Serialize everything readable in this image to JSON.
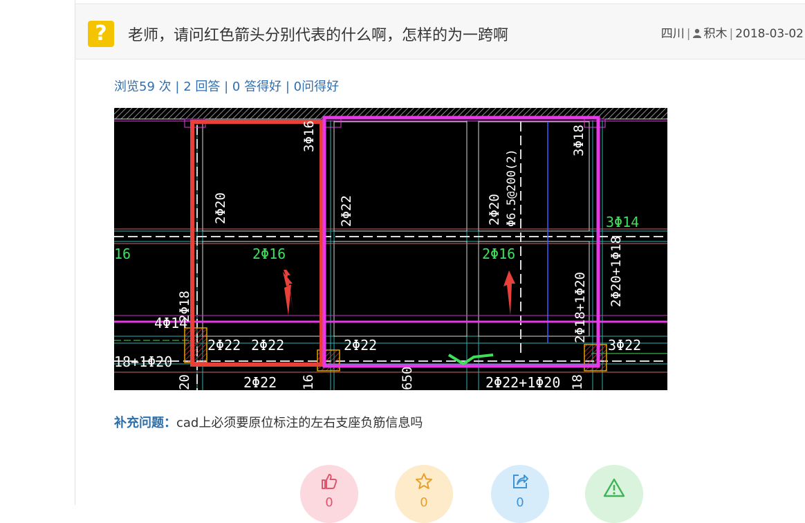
{
  "question": {
    "icon": "question-icon",
    "icon_glyph": "?",
    "title": "老师，请问红色箭头分别代表的什么啊，怎样的为一跨啊",
    "region": "四川",
    "author": "积木",
    "date": "2018-03-02"
  },
  "stats": {
    "views": "浏览59 次",
    "answers": "2 回答",
    "good_answers": "0 答得好",
    "good_questions": "0问得好",
    "separator": "|"
  },
  "cad_image": {
    "labels": {
      "l1": "3Φ16",
      "l2": "3Φ18",
      "l3": "2Φ20",
      "l4": "2Φ22",
      "l5": "2Φ20",
      "l6": "Φ6.5@200(2)",
      "l7": "3Φ14",
      "l8": "16",
      "l9": "2Φ16",
      "l10": "2Φ16",
      "l11": "2Φ20+1Φ18",
      "l12": "2Φ18+1Φ20",
      "l13": "2Φ18",
      "l14": "4Φ14",
      "l15": "2Φ22",
      "l16": "2Φ22",
      "l17": "2Φ22",
      "l18": "3Φ22",
      "l19": "18+1Φ20",
      "l20": "2Φ22",
      "l21": "16",
      "l22": "650",
      "l23": "2Φ22+1Φ20",
      "l24": "18",
      "l25": "20"
    },
    "colors": {
      "red_box": "#e8413a",
      "magenta_box": "#e63ae6",
      "arrow": "#e8413a",
      "text_white": "#ffffff",
      "text_green": "#3ee05a",
      "cyan_line": "#2fb3b3"
    }
  },
  "supplement": {
    "label": "补充问题：",
    "text": "cad上必须要原位标注的左右支座负筋信息吗"
  },
  "actions": [
    {
      "name": "like",
      "icon": "thumbs-up-icon",
      "count": "0",
      "color": "#e2546b"
    },
    {
      "name": "favorite",
      "icon": "star-icon",
      "count": "0",
      "color": "#e6a02a"
    },
    {
      "name": "share",
      "icon": "share-icon",
      "count": "0",
      "color": "#3d94d9"
    },
    {
      "name": "report",
      "icon": "warning-icon",
      "count": "",
      "color": "#3fb457"
    }
  ]
}
